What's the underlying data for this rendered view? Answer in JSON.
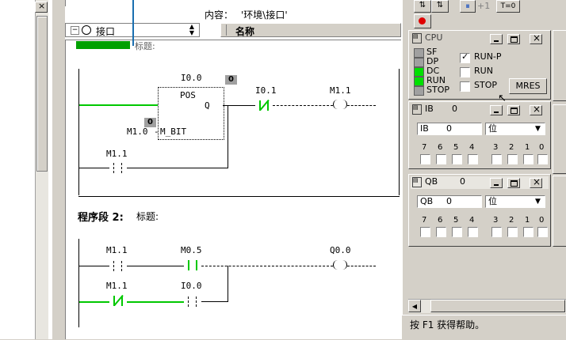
{
  "editor": {
    "env_label": "内容：",
    "env_value": "'环境\\接口'",
    "iface_item": "接口",
    "col_name": "名称",
    "network1_title_partial": "标题:",
    "network2": {
      "label": "程序段 2:",
      "title": "标题:"
    }
  },
  "rung1": {
    "pos_addr": "I0.0",
    "pos_box_label": "POS",
    "pos_output": "Q",
    "pos_mbit_addr": "M1.0",
    "pos_mbit_pin": "M_BIT",
    "pos_status": "0",
    "mbit_status": "0",
    "nc_contact_addr": "I0.1",
    "coil_addr": "M1.1",
    "seal_contact_addr": "M1.1"
  },
  "rung2": {
    "c1_addr": "M1.1",
    "c2_addr": "M0.5",
    "coil_addr": "Q0.0",
    "c3_addr": "M1.1",
    "c4_addr": "I0.0"
  },
  "toolbar": {
    "pause_icon": "⏸",
    "step_label": "+1",
    "timer_label": "T=0"
  },
  "cpu": {
    "title": "CPU",
    "leds": [
      "SF",
      "DP",
      "DC",
      "RUN",
      "STOP"
    ],
    "led_colors": [
      "#a0a0a0",
      "#a0a0a0",
      "#00e000",
      "#00e000",
      "#a0a0a0"
    ],
    "modes": [
      "RUN-P",
      "RUN",
      "STOP"
    ],
    "mode_checked": "RUN-P",
    "mres_label": "MRES"
  },
  "ib": {
    "title": "IB",
    "title_value": "0",
    "addr": "IB",
    "value": "0",
    "format": "位",
    "bits": [
      "7",
      "6",
      "5",
      "4",
      "3",
      "2",
      "1",
      "0"
    ]
  },
  "qb": {
    "title": "QB",
    "title_value": "0",
    "addr": "QB",
    "value": "0",
    "format": "位",
    "bits": [
      "7",
      "6",
      "5",
      "4",
      "3",
      "2",
      "1",
      "0"
    ]
  },
  "status": {
    "help_text": "按 F1 获得帮助。"
  },
  "colors": {
    "energized": "#00c800",
    "status_box": "#a0a0a0",
    "selection_marker": "#1a6fb0"
  }
}
